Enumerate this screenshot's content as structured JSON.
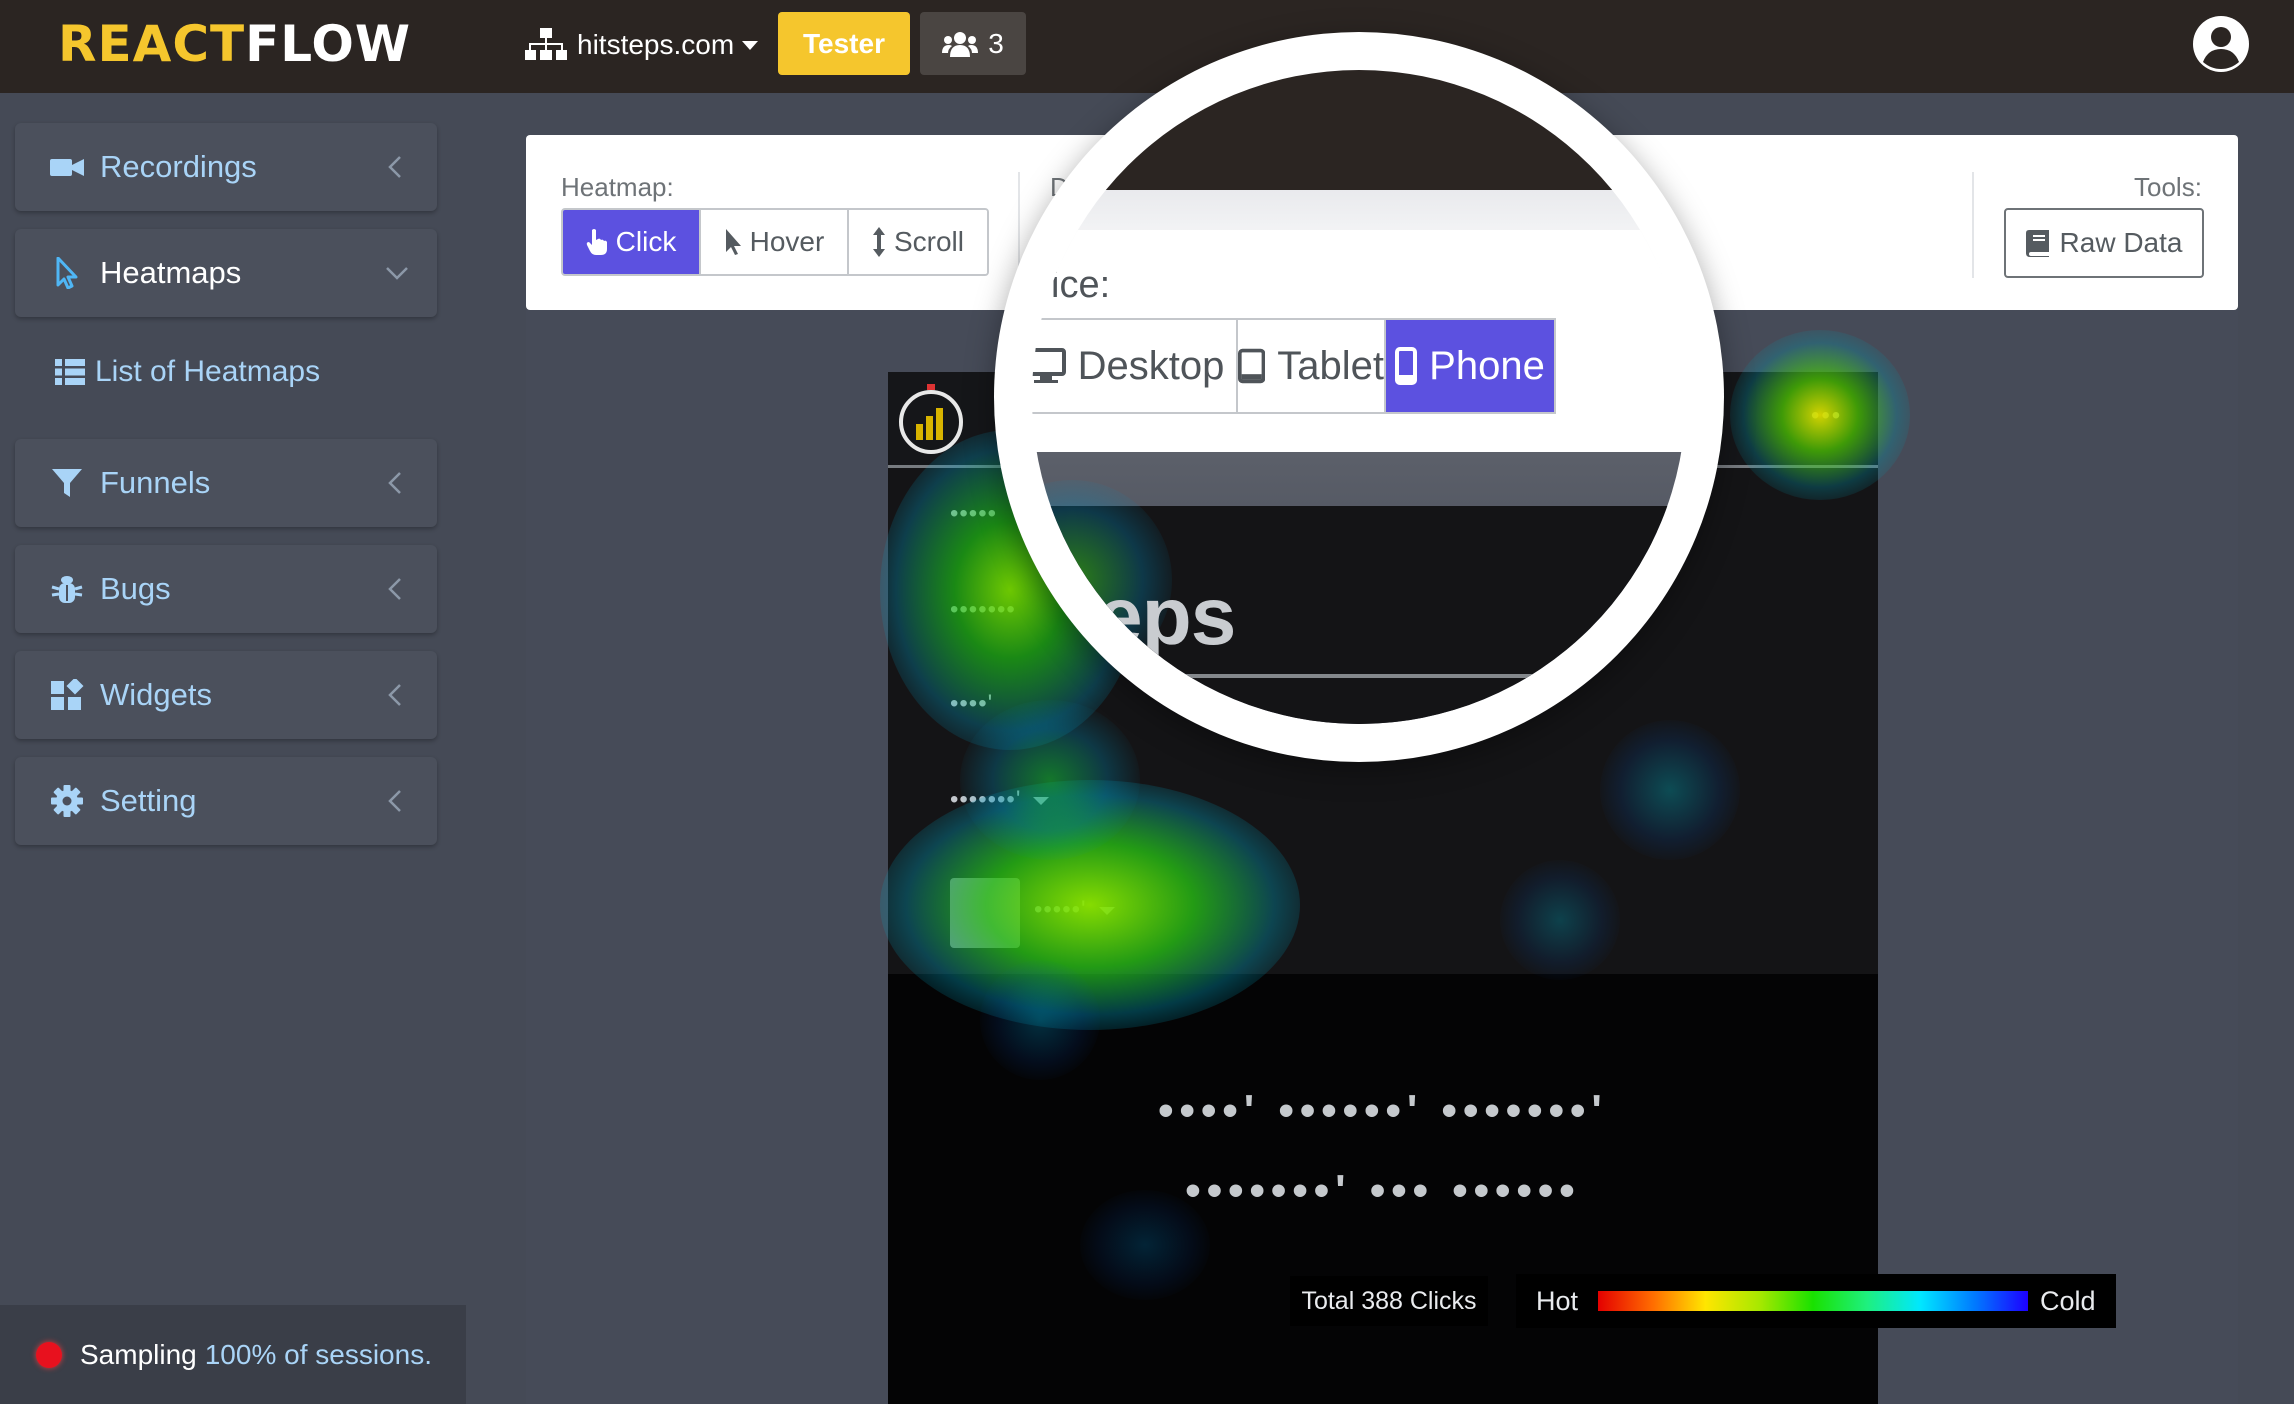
{
  "topbar": {
    "logo_part1": "REACT",
    "logo_part2": "FLOW",
    "site": "hitsteps.com",
    "tester_label": "Tester",
    "users_count": "3"
  },
  "sidebar": {
    "items": [
      {
        "label": "Recordings"
      },
      {
        "label": "Heatmaps"
      },
      {
        "label": "Funnels"
      },
      {
        "label": "Bugs"
      },
      {
        "label": "Widgets"
      },
      {
        "label": "Setting"
      }
    ],
    "submenu": {
      "label": "List of Heatmaps"
    },
    "sampling": {
      "label": "Sampling",
      "value": "100% of sessions."
    }
  },
  "toolbar": {
    "heatmap_label": "Heatmap:",
    "modes": [
      "Click",
      "Hover",
      "Scroll"
    ],
    "active_mode": "Click",
    "device_label_partial": "D",
    "tools_label": "Tools:",
    "raw_data_label": "Raw Data"
  },
  "magnifier": {
    "device_label_partial": "vice:",
    "devices": [
      "Desktop",
      "Tablet",
      "Phone"
    ],
    "active_device": "Phone",
    "page_text_partial": "eps"
  },
  "phone_page": {
    "menu_dots": "•••",
    "nav_items": [
      "•••••",
      "•••••••",
      "••••'",
      "•••••••'",
      "•••••'"
    ],
    "hero_line1": "••••' ••••••' •••••••'",
    "hero_line2": "•••••••' ••• ••••••"
  },
  "legend": {
    "total_clicks": "Total 388 Clicks",
    "hot_label": "Hot",
    "cold_label": "Cold"
  }
}
